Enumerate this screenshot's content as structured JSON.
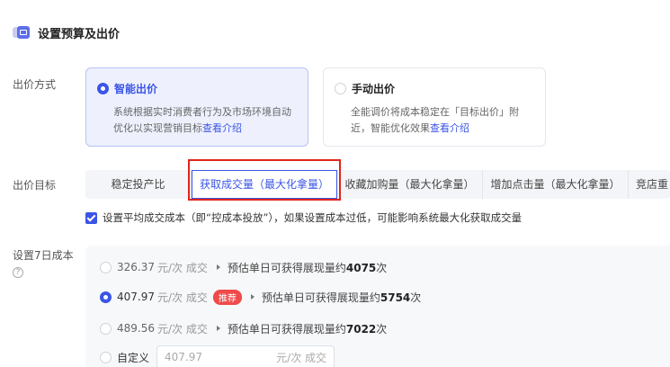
{
  "section": {
    "title": "设置预算及出价",
    "icon": "ticket-icon"
  },
  "bid_method": {
    "label": "出价方式",
    "options": [
      {
        "title": "智能出价",
        "desc": "系统根据实时消费者行为及市场环境自动优化以实现营销目标",
        "link": "查看介绍",
        "selected": true
      },
      {
        "title": "手动出价",
        "desc": "全能调价将成本稳定在「目标出价」附近，智能优化效果",
        "link": "查看介绍",
        "selected": false
      }
    ]
  },
  "bid_goal": {
    "label": "出价目标",
    "tabs": [
      "稳定投产比",
      "获取成交量（最大化拿量）",
      "收藏加购量（最大化拿量）",
      "增加点击量（最大化拿量）",
      "竞店重"
    ],
    "active_tab": 1
  },
  "avg_cost_checkbox": {
    "label": "设置平均成交成本（即“控成本投放”），如果设置成本过低，可能影响系统最大化获取成交量",
    "checked": true
  },
  "cost": {
    "label": "设置7日成本",
    "options": [
      {
        "price": "326.37",
        "unit": "元/次 成交",
        "estimate_prefix": "预估单日可获得展现量约",
        "estimate_value": "4075",
        "estimate_suffix": "次",
        "recommended": false,
        "selected": false
      },
      {
        "price": "407.97",
        "unit": "元/次 成交",
        "estimate_prefix": "预估单日可获得展现量约",
        "estimate_value": "5754",
        "estimate_suffix": "次",
        "recommended": true,
        "selected": true
      },
      {
        "price": "489.56",
        "unit": "元/次 成交",
        "estimate_prefix": "预估单日可获得展现量约",
        "estimate_value": "7022",
        "estimate_suffix": "次",
        "recommended": false,
        "selected": false
      }
    ],
    "recommend_tag": "推荐",
    "custom": {
      "label": "自定义",
      "placeholder": "407.97",
      "unit": "元/次 成交"
    }
  },
  "colors": {
    "accent": "#3b55e6",
    "highlight": "#e1251b",
    "recommend": "#f04a4a"
  }
}
